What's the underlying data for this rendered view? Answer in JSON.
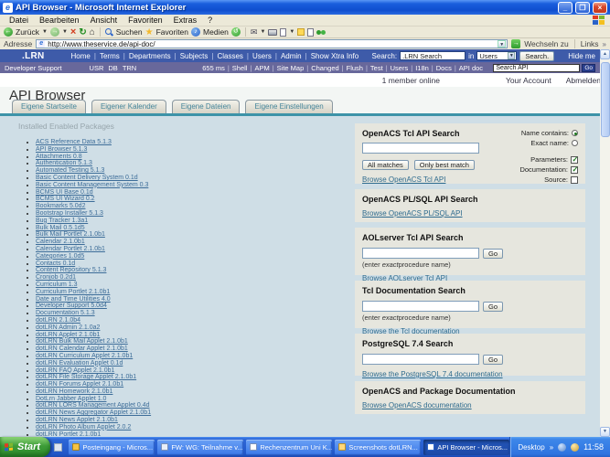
{
  "window": {
    "title": "API Browser - Microsoft Internet Explorer",
    "menu_items": [
      "Datei",
      "Bearbeiten",
      "Ansicht",
      "Favoriten",
      "Extras",
      "?"
    ],
    "toolbar": {
      "back": "Zurück",
      "search": "Suchen",
      "favorites": "Favoriten",
      "media": "Medien"
    },
    "address": {
      "label": "Adresse",
      "url": "http://www.theservice.de/api-doc/",
      "go": "Wechseln zu",
      "links": "Links"
    }
  },
  "navbar": {
    "brand": ".LRN",
    "links": [
      "Home",
      "Terms",
      "Departments",
      "Subjects",
      "Classes",
      "Users",
      "Admin",
      "Show Xtra Info"
    ],
    "search_label": "Search:",
    "search_value": ".LRN Search",
    "in_label": "in",
    "scope_value": "Users",
    "search_button": "Search.",
    "hide_me": "Hide me"
  },
  "devbar": {
    "title": "Developer Support",
    "flags": [
      "USR",
      "DB",
      "TRN"
    ],
    "links": [
      "655 ms",
      "Shell",
      "APM",
      "Site Map",
      "Changed",
      "Flush",
      "Test",
      "Users",
      "I18n",
      "Docs",
      "API doc"
    ],
    "search_value": "Search API",
    "go": "Go"
  },
  "statusbar": {
    "members": "1 member online",
    "account": "Your Account",
    "logout": "Abmelden"
  },
  "page": {
    "title": "API Browser",
    "tabs": [
      "Eigene Startseite",
      "Eigener Kalender",
      "Eigene Dateien",
      "Eigene Einstellungen"
    ],
    "packages_header": "Installed Enabled Packages",
    "packages": [
      "ACS Reference Data 5.1.3",
      "API Browser 5.1.3",
      "Attachments 0.8",
      "Authentication 5.1.3",
      "Automated Testing 5.1.3",
      "Basic Content Delivery System 0.1d",
      "Basic Content Management System 0.3",
      "BCMS UI Base 0.1d",
      "BCMS UI Wizard 0.2",
      "Bookmarks 5.0d2",
      "Bootstrap Installer 5.1.3",
      "Bug Tracker 1.3a1",
      "Bulk Mail 0.5.1d5",
      "Bulk Mail Portlet 2.1.0b1",
      "Calendar 2.1.0b1",
      "Calendar Portlet 2.1.0b1",
      "Categories 1.0d5",
      "Contacts 0.1d",
      "Content Repository 5.1.3",
      "Cronjob 0.2d1",
      "Curriculum 1.3",
      "Curriculum Portlet 2.1.0b1",
      "Date and Time Utilities 4.0",
      "Developer Support 5.0d4",
      "Documentation 5.1.3",
      "dotLRN 2.1.0b4",
      "dotLRN Admin 2.1.0a2",
      "dotLRN Applet 2.1.0b1",
      "dotLRN Bulk Mail Applet 2.1.0b1",
      "dotLRN Calendar Applet 2.1.0b1",
      "dotLRN Curriculum Applet 2.1.0b1",
      "dotLRN Evaluation Applet 0.1d",
      "dotLRN FAQ Applet 2.1.0b1",
      "dotLRN File Storage Applet 2.1.0b1",
      "dotLRN Forums Applet 2.1.0b1",
      "dotLRN Homework 2.1.0b1",
      "DotLrn Jabber Applet 1.0",
      "dotLRN LORS Management Applet 0.4d",
      "dotLRN News Aggregator Applet 2.1.0b1",
      "dotLRN News Applet 2.1.0b1",
      "dotLRN Photo Album Applet 2.0.2",
      "dotLRN Portlet 2.1.0b1"
    ]
  },
  "sections": {
    "tcl": {
      "title": "OpenACS Tcl API Search",
      "name_contains_label": "Name contains:",
      "exact_name_label": "Exact name:",
      "all_matches": "All matches",
      "best_match": "Only best match",
      "parameters_label": "Parameters:",
      "documentation_label": "Documentation:",
      "source_label": "Source:",
      "link": "Browse OpenACS Tcl API",
      "options": {
        "name_contains": true,
        "exact_name": false,
        "parameters": true,
        "documentation": true,
        "source": false
      }
    },
    "plsql": {
      "title": "OpenACS PL/SQL API Search",
      "link": "Browse OpenACS PL/SQL API"
    },
    "aolserver": {
      "title": "AOLserver Tcl API Search",
      "go": "Go",
      "hint_pre": "(enter ",
      "hint_em": "exact",
      "hint_post": "procedure name)",
      "link": "Browse AOLserver Tcl API"
    },
    "tcldoc": {
      "title": "Tcl Documentation Search",
      "go": "Go",
      "hint_pre": "(enter ",
      "hint_em": "exact",
      "hint_post": "procedure name)",
      "link": "Browse the Tcl documentation"
    },
    "postgres": {
      "title": "PostgreSQL 7.4 Search",
      "go": "Go",
      "link": "Browse the PostgreSQL 7.4 documentation"
    },
    "docs": {
      "title": "OpenACS and Package Documentation",
      "link": "Browse OpenACS documentation"
    }
  },
  "taskbar": {
    "start": "Start",
    "buttons": [
      {
        "label": "Posteingang - Micros...",
        "icon": "icon-outlook"
      },
      {
        "label": "FW: WG: Teilnahme v...",
        "icon": "icon-mail"
      },
      {
        "label": "Rechenzentrum Uni K...",
        "icon": "icon-page"
      },
      {
        "label": "Screenshots dotLRN...",
        "icon": "icon-folder"
      },
      {
        "label": "API Browser - Micros...",
        "icon": "icon-ie",
        "active": true
      }
    ],
    "desktop": "Desktop",
    "time": "11:58"
  },
  "colors": {
    "titlebar_blue": "#1a5edd",
    "navbar_blue": "#3e5ba9",
    "devbar_purple": "#68689b",
    "teal_rule": "#3d93a8",
    "package_link": "#3d6d99",
    "section_link": "#2e6b8e",
    "taskbar_blue": "#2e68d8",
    "start_green": "#3d9c38",
    "close_red": "#d8472b"
  }
}
